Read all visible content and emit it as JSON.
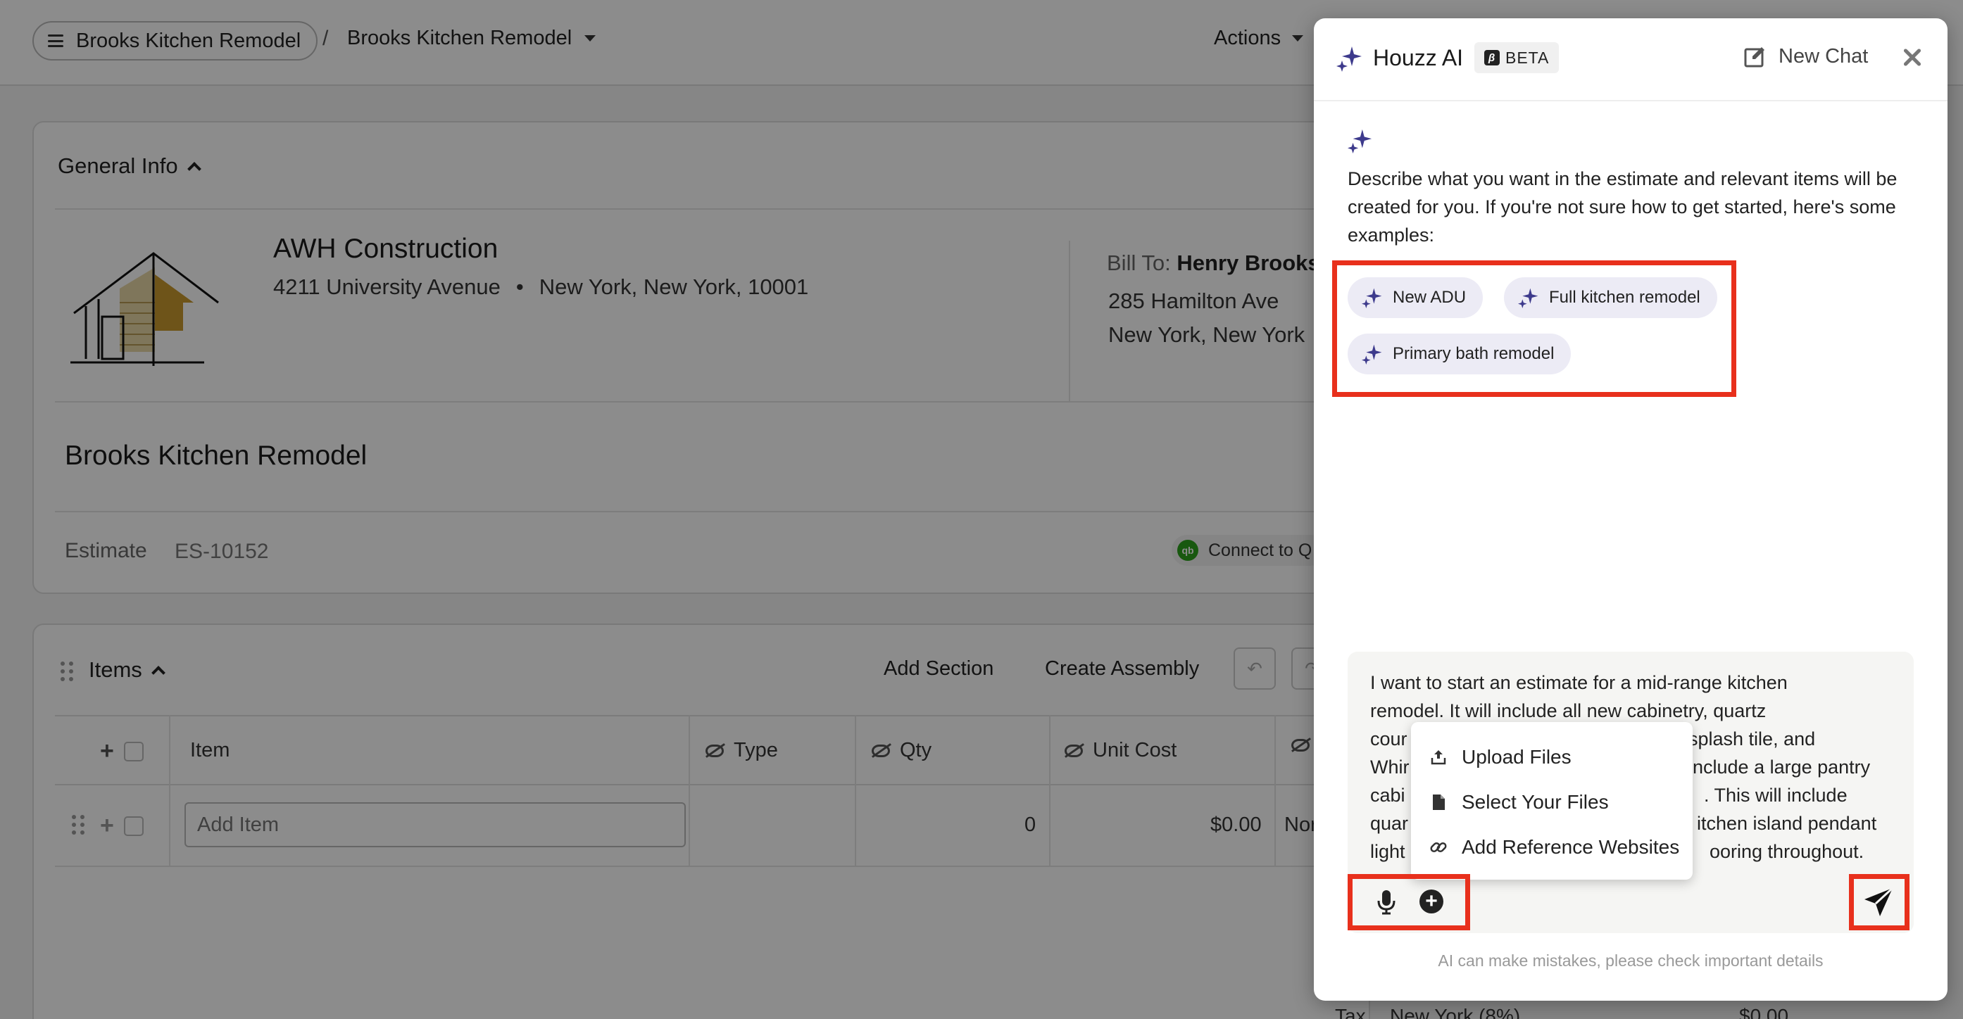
{
  "topbar": {
    "project_pill": "Brooks Kitchen Remodel",
    "separator": "/",
    "breadcrumb_current": "Brooks Kitchen Remodel",
    "actions_label": "Actions"
  },
  "general_info": {
    "title": "General Info",
    "company_name": "AWH Construction",
    "company_street": "4211 University Avenue",
    "company_city": "New York, New York, 10001",
    "bill_to_label": "Bill To:",
    "bill_to_name": "Henry Brooks",
    "bill_to_street": "285 Hamilton Ave",
    "bill_to_city": "New York, New York",
    "project_name": "Brooks Kitchen Remodel",
    "estimate_label": "Estimate",
    "estimate_number": "ES-10152",
    "quickbooks_label": "Connect to Q"
  },
  "items": {
    "title": "Items",
    "add_section": "Add Section",
    "create_assembly": "Create Assembly",
    "columns": [
      "Item",
      "Type",
      "Qty",
      "Unit Cost"
    ],
    "add_item_placeholder": "Add Item",
    "row_qty": "0",
    "row_unit_cost": "$0.00",
    "row_extra": "Nor",
    "tax_label": "Tax",
    "tax_value": "New York (8%)",
    "tax_amount": "$0.00"
  },
  "ai_panel": {
    "title": "Houzz AI",
    "beta": "BETA",
    "new_chat": "New Chat",
    "intro": "Describe what you want in the estimate and relevant items will be created for you. If you're not sure how to get started, here's some examples:",
    "examples": [
      "New ADU",
      "Full kitchen remodel",
      "Primary bath remodel"
    ],
    "input_lines": [
      "I want to start an estimate for a mid-range kitchen",
      "remodel. It will include all new cabinetry, quartz",
      "cour",
      "splash tile, and",
      "Whir",
      "nclude a large pantry",
      "cabi",
      ". This will include",
      "quar",
      "itchen island pendant",
      "light",
      "ooring throughout."
    ],
    "menu": [
      "Upload Files",
      "Select Your Files",
      "Add Reference Websites"
    ],
    "disclaimer": "AI can make mistakes, please check important details",
    "accent_color": "#3d3a8c",
    "highlight_color": "#e8301c"
  }
}
